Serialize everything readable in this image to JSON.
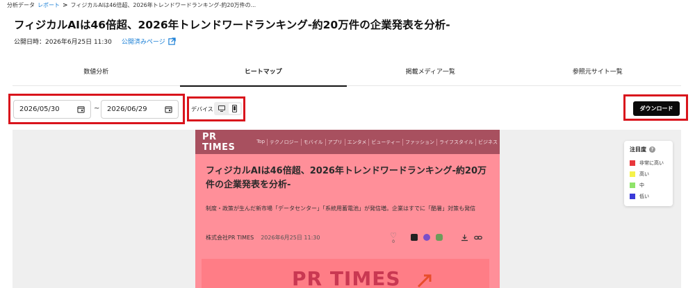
{
  "breadcrumb": {
    "items": [
      "分析データ",
      "レポート",
      "フィジカルAIは46倍超、2026年トレンドワードランキング-約20万件の..."
    ],
    "separator": ">"
  },
  "page": {
    "title": "フィジカルAIは46倍超、2026年トレンドワードランキング-約20万件の企業発表を分析-",
    "published_label": "公開日時：2026年6月25日 11:30",
    "published_link": "公開済みページ"
  },
  "tabs": [
    {
      "label": "数値分析",
      "active": false
    },
    {
      "label": "ヒートマップ",
      "active": true
    },
    {
      "label": "掲載メディア一覧",
      "active": false
    },
    {
      "label": "参照元サイト一覧",
      "active": false
    }
  ],
  "controls": {
    "date_from": "2026/05/30",
    "date_to": "2026/06/29",
    "range_separator": "~",
    "device_label": "デバイス",
    "device_options": [
      "desktop-icon",
      "mobile-icon"
    ],
    "device_selected": "mobile",
    "download_label": "ダウンロード"
  },
  "article": {
    "logo": "PR TIMES",
    "nav": [
      "Top",
      "テクノロジー",
      "モバイル",
      "アプリ",
      "エンタメ",
      "ビューティー",
      "ファッション",
      "ライフスタイル",
      "ビジネス"
    ],
    "title": "フィジカルAIは46倍超、2026年トレンドワードランキング-約20万件の企業発表を分析-",
    "lead": "制度・政策が生んだ新市場「データセンター」「系統用蓄電池」が発信増。企業はすでに「酷暑」対策も発信",
    "company": "株式会社PR TIMES",
    "date": "2026年6月25日 11:30",
    "like_count": "0",
    "image_logo": "PR TIMES"
  },
  "legend": {
    "title": "注目度",
    "items": [
      {
        "label": "非常に高い",
        "color": "#e8373c"
      },
      {
        "label": "高い",
        "color": "#f5f24a"
      },
      {
        "label": "中",
        "color": "#8fe36a"
      },
      {
        "label": "低い",
        "color": "#3a3ad8"
      }
    ]
  },
  "colors": {
    "accent_link": "#1a7fd6",
    "highlight_box": "#d9141c",
    "heat_overlay": "#ff8f99"
  }
}
